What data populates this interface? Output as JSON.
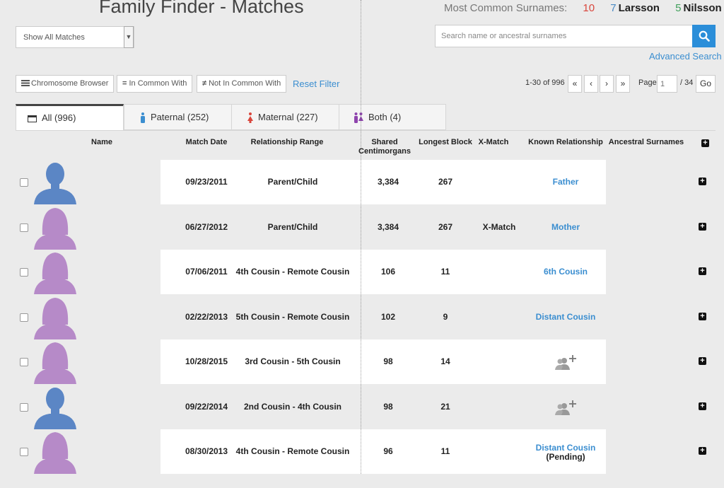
{
  "header": {
    "title": "Family Finder - Matches",
    "surnames_label": "Most Common Surnames:",
    "surnames": [
      {
        "count": "10",
        "name": ""
      },
      {
        "count": "7",
        "name": "Larsson"
      },
      {
        "count": "5",
        "name": "Nilsson"
      }
    ]
  },
  "filter": {
    "selected": "Show All Matches"
  },
  "search": {
    "placeholder": "Search name or ancestral surnames",
    "advanced": "Advanced Search"
  },
  "toolbar": {
    "chromosome_browser": "Chromosome Browser",
    "in_common_with": "In Common With",
    "not_in_common_with": "Not In Common With",
    "reset_filter": "Reset Filter"
  },
  "pager": {
    "count": "1-30 of 996",
    "first": "«",
    "prev": "‹",
    "next": "›",
    "last": "»",
    "page_label": "Page",
    "page_placeholder": "1",
    "total": "/ 34",
    "go": "Go"
  },
  "tabs": [
    {
      "label": "All (996)"
    },
    {
      "label": "Paternal (252)"
    },
    {
      "label": "Maternal (227)"
    },
    {
      "label": "Both (4)"
    }
  ],
  "columns": {
    "name": "Name",
    "match_date": "Match Date",
    "relationship_range": "Relationship Range",
    "shared_cm_1": "Shared",
    "shared_cm_2": "Centimorgans",
    "longest_block": "Longest Block",
    "x_match": "X-Match",
    "known_relationship": "Known Relationship",
    "ancestral_surnames": "Ancestral Surnames"
  },
  "colors": {
    "male": "#5b86c5",
    "female": "#b68ac8",
    "accent": "#3b8ed0"
  },
  "rows": [
    {
      "gender": "male",
      "date": "09/23/2011",
      "range": "Parent/Child",
      "cm": "3,384",
      "block": "267",
      "xmatch": "",
      "known": "Father",
      "pending": ""
    },
    {
      "gender": "female",
      "date": "06/27/2012",
      "range": "Parent/Child",
      "cm": "3,384",
      "block": "267",
      "xmatch": "X-Match",
      "known": "Mother",
      "pending": ""
    },
    {
      "gender": "female",
      "date": "07/06/2011",
      "range": "4th Cousin - Remote Cousin",
      "cm": "106",
      "block": "11",
      "xmatch": "",
      "known": "6th Cousin",
      "pending": ""
    },
    {
      "gender": "female",
      "date": "02/22/2013",
      "range": "5th Cousin - Remote Cousin",
      "cm": "102",
      "block": "9",
      "xmatch": "",
      "known": "Distant Cousin",
      "pending": ""
    },
    {
      "gender": "female",
      "date": "10/28/2015",
      "range": "3rd Cousin - 5th Cousin",
      "cm": "98",
      "block": "14",
      "xmatch": "",
      "known": "",
      "pending": ""
    },
    {
      "gender": "male",
      "date": "09/22/2014",
      "range": "2nd Cousin - 4th Cousin",
      "cm": "98",
      "block": "21",
      "xmatch": "",
      "known": "",
      "pending": ""
    },
    {
      "gender": "female",
      "date": "08/30/2013",
      "range": "4th Cousin - Remote Cousin",
      "cm": "96",
      "block": "11",
      "xmatch": "",
      "known": "Distant Cousin",
      "pending": "(Pending)"
    }
  ]
}
